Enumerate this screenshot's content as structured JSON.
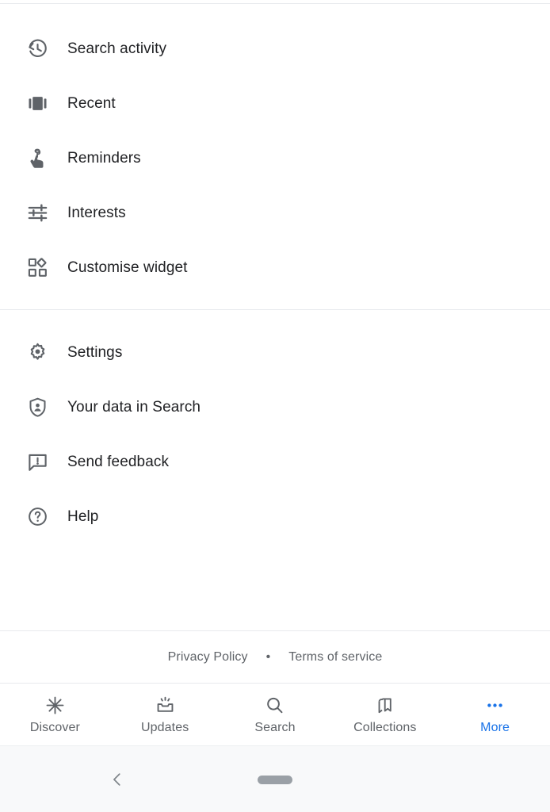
{
  "menu": {
    "groups": [
      {
        "items": [
          {
            "label": "Search activity",
            "icon": "history-icon"
          },
          {
            "label": "Recent",
            "icon": "recent-cards-icon"
          },
          {
            "label": "Reminders",
            "icon": "finger-string-icon"
          },
          {
            "label": "Interests",
            "icon": "tune-sliders-icon"
          },
          {
            "label": "Customise widget",
            "icon": "widgets-icon"
          }
        ]
      },
      {
        "items": [
          {
            "label": "Settings",
            "icon": "gear-icon"
          },
          {
            "label": "Your data in Search",
            "icon": "shield-person-icon"
          },
          {
            "label": "Send feedback",
            "icon": "feedback-bubble-icon"
          },
          {
            "label": "Help",
            "icon": "help-circle-icon"
          }
        ]
      }
    ]
  },
  "footer": {
    "privacy_policy": "Privacy Policy",
    "separator": "•",
    "terms_of_service": "Terms of service"
  },
  "bottom_nav": {
    "active_color": "#1a73e8",
    "inactive_color": "#5f6368",
    "items": [
      {
        "label": "Discover",
        "icon": "asterisk-star-icon",
        "active": false
      },
      {
        "label": "Updates",
        "icon": "inbox-tray-icon",
        "active": false
      },
      {
        "label": "Search",
        "icon": "magnifier-icon",
        "active": false
      },
      {
        "label": "Collections",
        "icon": "bookmark-collections-icon",
        "active": false
      },
      {
        "label": "More",
        "icon": "three-dots-icon",
        "active": true
      }
    ]
  },
  "system_nav": {
    "back": "back-chevron",
    "home": "home-pill"
  }
}
